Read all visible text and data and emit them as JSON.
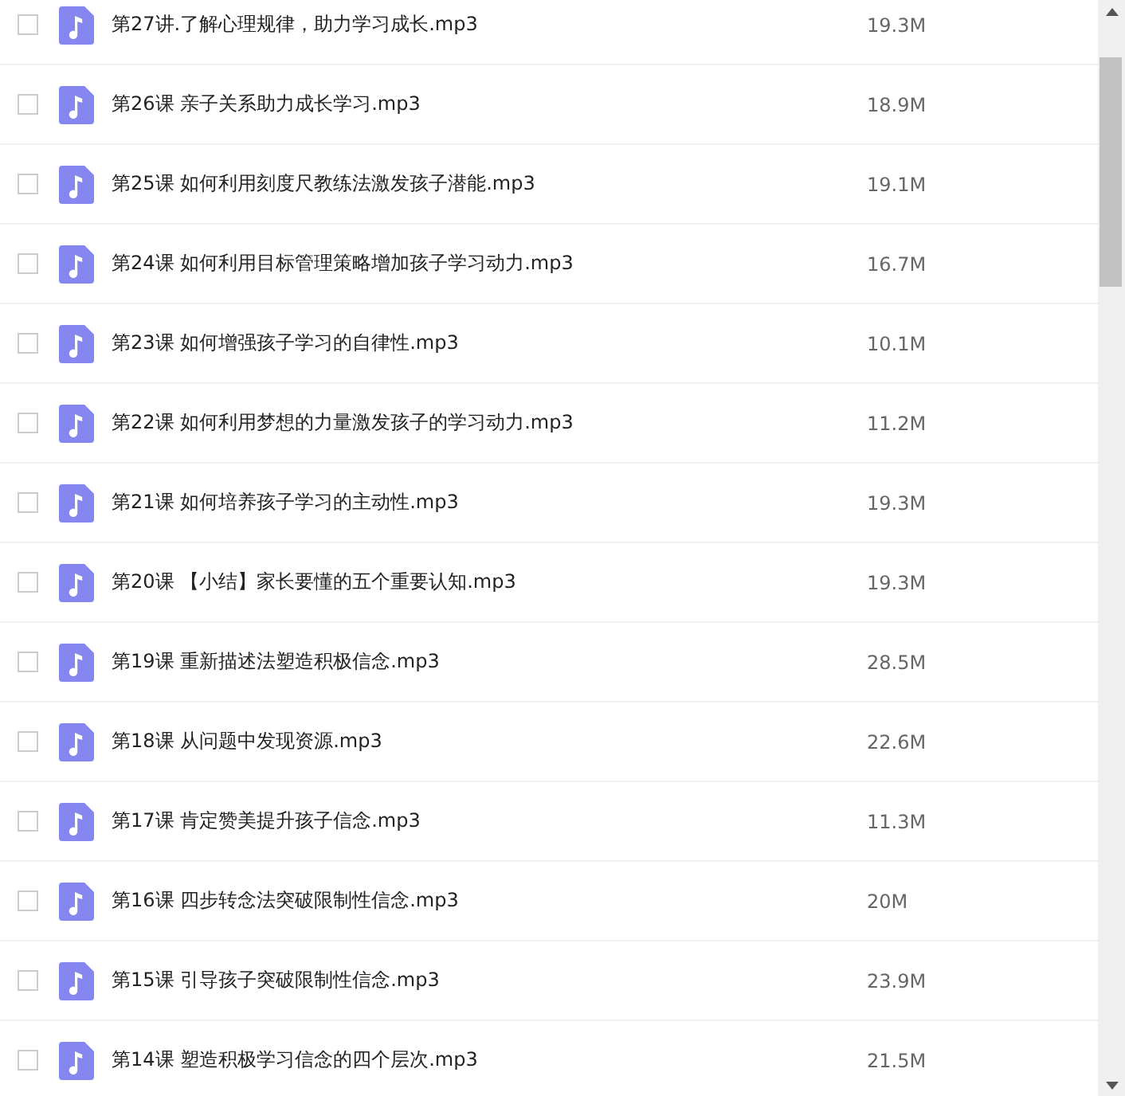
{
  "files": [
    {
      "name": "第27讲.了解心理规律，助力学习成长.mp3",
      "size": "19.3M",
      "checked": false
    },
    {
      "name": "第26课 亲子关系助力成长学习.mp3",
      "size": "18.9M",
      "checked": false
    },
    {
      "name": "第25课 如何利用刻度尺教练法激发孩子潜能.mp3",
      "size": "19.1M",
      "checked": false
    },
    {
      "name": "第24课 如何利用目标管理策略增加孩子学习动力.mp3",
      "size": "16.7M",
      "checked": false
    },
    {
      "name": "第23课 如何增强孩子学习的自律性.mp3",
      "size": "10.1M",
      "checked": false
    },
    {
      "name": "第22课 如何利用梦想的力量激发孩子的学习动力.mp3",
      "size": "11.2M",
      "checked": false
    },
    {
      "name": "第21课 如何培养孩子学习的主动性.mp3",
      "size": "19.3M",
      "checked": false
    },
    {
      "name": "第20课 【小结】家长要懂的五个重要认知.mp3",
      "size": "19.3M",
      "checked": false
    },
    {
      "name": "第19课 重新描述法塑造积极信念.mp3",
      "size": "28.5M",
      "checked": false
    },
    {
      "name": "第18课 从问题中发现资源.mp3",
      "size": "22.6M",
      "checked": false
    },
    {
      "name": "第17课 肯定赞美提升孩子信念.mp3",
      "size": "11.3M",
      "checked": false
    },
    {
      "name": "第16课 四步转念法突破限制性信念.mp3",
      "size": "20M",
      "checked": false
    },
    {
      "name": "第15课 引导孩子突破限制性信念.mp3",
      "size": "23.9M",
      "checked": false
    },
    {
      "name": "第14课 塑造积极学习信念的四个层次.mp3",
      "size": "21.5M",
      "checked": false
    }
  ]
}
